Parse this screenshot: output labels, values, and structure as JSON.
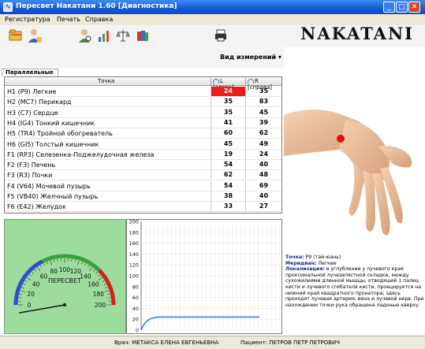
{
  "window": {
    "title": "Пересвет Накатани 1.60 [Диагностика]",
    "app_icon": "wave-icon"
  },
  "menu": [
    "Регистратура",
    "Печать",
    "Справка"
  ],
  "toolbar": {
    "icons": [
      "folder-open-icon",
      "patient-icon",
      "diagnostics-icon",
      "measure-chart-icon",
      "balance-icon",
      "books-icon",
      "printer-icon"
    ]
  },
  "brand": "NAKATANI",
  "panel": {
    "view_label": "Вид измерений ▾",
    "tab_label": "Параллельные"
  },
  "table": {
    "headers": {
      "point": "Точка",
      "left": "L [слева]",
      "right": "R [справа]"
    },
    "rows": [
      {
        "point": "H1  (P9)  Легкие",
        "left": "24",
        "right": "35",
        "left_high": true
      },
      {
        "point": "H2  (MC7)  Перикард",
        "left": "35",
        "right": "83"
      },
      {
        "point": "H3  (C7)  Сердце",
        "left": "35",
        "right": "45"
      },
      {
        "point": "H4  (IG4)  Тонкий кишечник",
        "left": "41",
        "right": "39"
      },
      {
        "point": "H5  (TR4)  Тройной обогреватель",
        "left": "60",
        "right": "62"
      },
      {
        "point": "H6  (GI5)  Толстый кишечник",
        "left": "45",
        "right": "49"
      },
      {
        "point": "F1  (RP3)  Селезенка-Поджелудочная железа",
        "left": "19",
        "right": "24"
      },
      {
        "point": "F2  (F3)  Печень",
        "left": "54",
        "right": "40"
      },
      {
        "point": "F3  (R3)  Почки",
        "left": "62",
        "right": "48"
      },
      {
        "point": "F4  (V64)  Мочевой пузырь",
        "left": "54",
        "right": "69"
      },
      {
        "point": "F5  (VB40)  Желчный пузырь",
        "left": "38",
        "right": "40"
      },
      {
        "point": "F6  (E42)  Желудок",
        "left": "33",
        "right": "27"
      }
    ]
  },
  "gauge": {
    "label": "ПЕРЕСВЕТ",
    "ticks": [
      "0",
      "20",
      "40",
      "60",
      "80",
      "100",
      "120",
      "140",
      "160",
      "180",
      "200"
    ],
    "value": 2
  },
  "graph": {
    "y_ticks": [
      "200",
      "180",
      "160",
      "140",
      "120",
      "100",
      "80",
      "60",
      "40",
      "20",
      "0"
    ],
    "ylim": [
      0,
      200
    ],
    "level": 24
  },
  "info": {
    "point_label": "Точка:",
    "point_value": "P9 (тай-юань)",
    "meridian_label": "Меридиан:",
    "meridian_value": "Легкие",
    "loc_label": "Локализация:",
    "loc_value": "в углублении у лучевого края проксимальной лучезапястной складки, между сухожилиями длинной мышцы, отводящей 1 палец кисти и лучевого сгибателя кисти, проецируется на нижний край квадратного пронатора; здесь проходят лучевая артерия, вена и лучевой нерв. При нахождении точки рука обращена ладонью кверху."
  },
  "status": {
    "doctor": "Врач: МЕТАКСА ЕЛЕНА ЕВГЕНЬЕВНА",
    "patient": "Пациент: ПЕТРОВ ПЕТР ПЕТРОВИЧ"
  }
}
